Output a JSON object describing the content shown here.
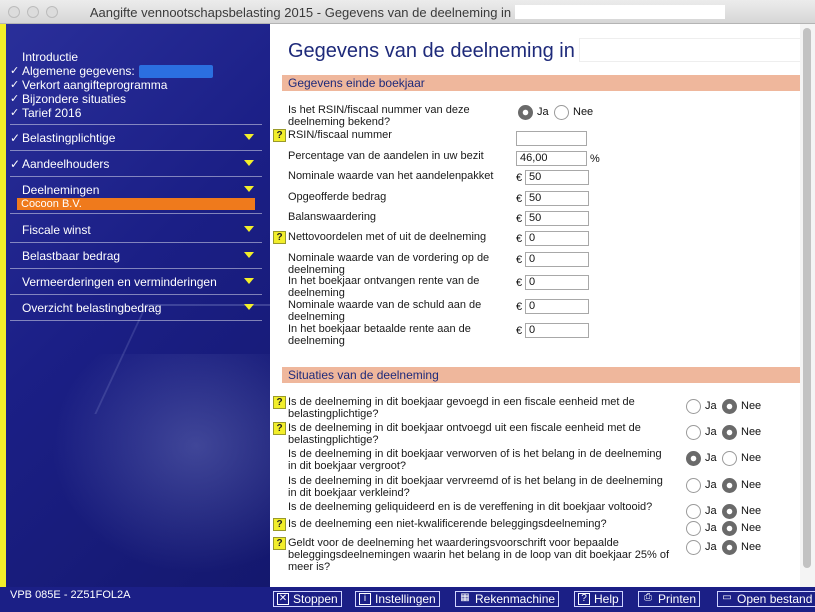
{
  "window": {
    "title": "Aangifte vennootschapsbelasting 2015 - Gegevens van de deelneming in"
  },
  "sidebar": {
    "intro": [
      {
        "label": "Introductie",
        "checked": false
      },
      {
        "label": "Algemene gegevens:",
        "checked": true
      },
      {
        "label": "Verkort aangifteprogramma",
        "checked": true
      },
      {
        "label": "Bijzondere situaties",
        "checked": true
      },
      {
        "label": "Tarief 2016",
        "checked": true
      }
    ],
    "nav": [
      {
        "label": "Belastingplichtige",
        "checked": true
      },
      {
        "label": "Aandeelhouders",
        "checked": true
      },
      {
        "label": "Deelnemingen",
        "checked": false
      },
      {
        "label": "Fiscale winst",
        "checked": false
      },
      {
        "label": "Belastbaar bedrag",
        "checked": false
      },
      {
        "label": "Vermeerderingen en verminderingen",
        "checked": false
      },
      {
        "label": "Overzicht belastingbedrag",
        "checked": false
      }
    ],
    "selected_subitem": "Cocoon B.V.",
    "version": "VPB 085E - 2Z51FOL2A",
    "accent_color": "#ef7a1c"
  },
  "main": {
    "heading": "Gegevens van de deelneming in",
    "section1": "Gegevens einde boekjaar",
    "q_rsin_known": "Is het RSIN/fiscaal nummer van deze deelneming bekend?",
    "rsin_yes": "Ja",
    "rsin_no": "Nee",
    "rsin_label": "RSIN/fiscaal nummer",
    "rsin_value": "",
    "pct_label": "Percentage van de aandelen in uw bezit",
    "pct_value": "46,00",
    "pct_unit": "%",
    "currency": "€",
    "amounts": [
      {
        "label": "Nominale waarde van het aandelenpakket",
        "value": "50",
        "help": false
      },
      {
        "label": "Opgeofferde bedrag",
        "value": "50",
        "help": false
      },
      {
        "label": "Balanswaardering",
        "value": "50",
        "help": false
      },
      {
        "label": "Nettovoordelen met of uit de deelneming",
        "value": "0",
        "help": true
      },
      {
        "label": "Nominale waarde van de vordering op de deelneming",
        "value": "0",
        "help": false
      },
      {
        "label": "In het boekjaar ontvangen rente van de deelneming",
        "value": "0",
        "help": false
      },
      {
        "label": "Nominale waarde van de schuld aan de deelneming",
        "value": "0",
        "help": false
      },
      {
        "label": "In het boekjaar betaalde rente aan de deelneming",
        "value": "0",
        "help": false
      }
    ],
    "section2": "Situaties van de deelneming",
    "situations": [
      {
        "label": "Is de deelneming in dit boekjaar gevoegd in een fiscale eenheid met de belastingplichtige?",
        "help": true,
        "answer": "Nee"
      },
      {
        "label": "Is de deelneming in dit boekjaar ontvoegd uit een fiscale eenheid met de belastingplichtige?",
        "help": true,
        "answer": "Nee"
      },
      {
        "label": "Is de deelneming in dit boekjaar verworven of is het belang in de deelneming in dit boekjaar vergroot?",
        "help": false,
        "answer": "Ja"
      },
      {
        "label": "Is de deelneming in dit boekjaar vervreemd of is het belang in de deelneming in dit boekjaar verkleind?",
        "help": false,
        "answer": "Nee"
      },
      {
        "label": "Is de deelneming geliquideerd en is de vereffening in dit boekjaar voltooid?",
        "help": false,
        "answer": "Nee"
      },
      {
        "label": "Is de deelneming een niet-kwalificerende beleggingsdeelneming?",
        "help": true,
        "answer": "Nee"
      },
      {
        "label": "Geldt voor de deelneming het waarderingsvoorschrift voor bepaalde beleggingsdeelnemingen waarin het belang in de loop van dit boekjaar 25% of meer is?",
        "help": true,
        "answer": "Nee"
      }
    ],
    "yes": "Ja",
    "no": "Nee",
    "section_color": "#efb79c"
  },
  "toolbar": {
    "stoppen": "Stoppen",
    "instellingen": "Instellingen",
    "rekenmachine": "Rekenmachine",
    "help": "Help",
    "printen": "Printen",
    "open_bestand": "Open bestand"
  }
}
